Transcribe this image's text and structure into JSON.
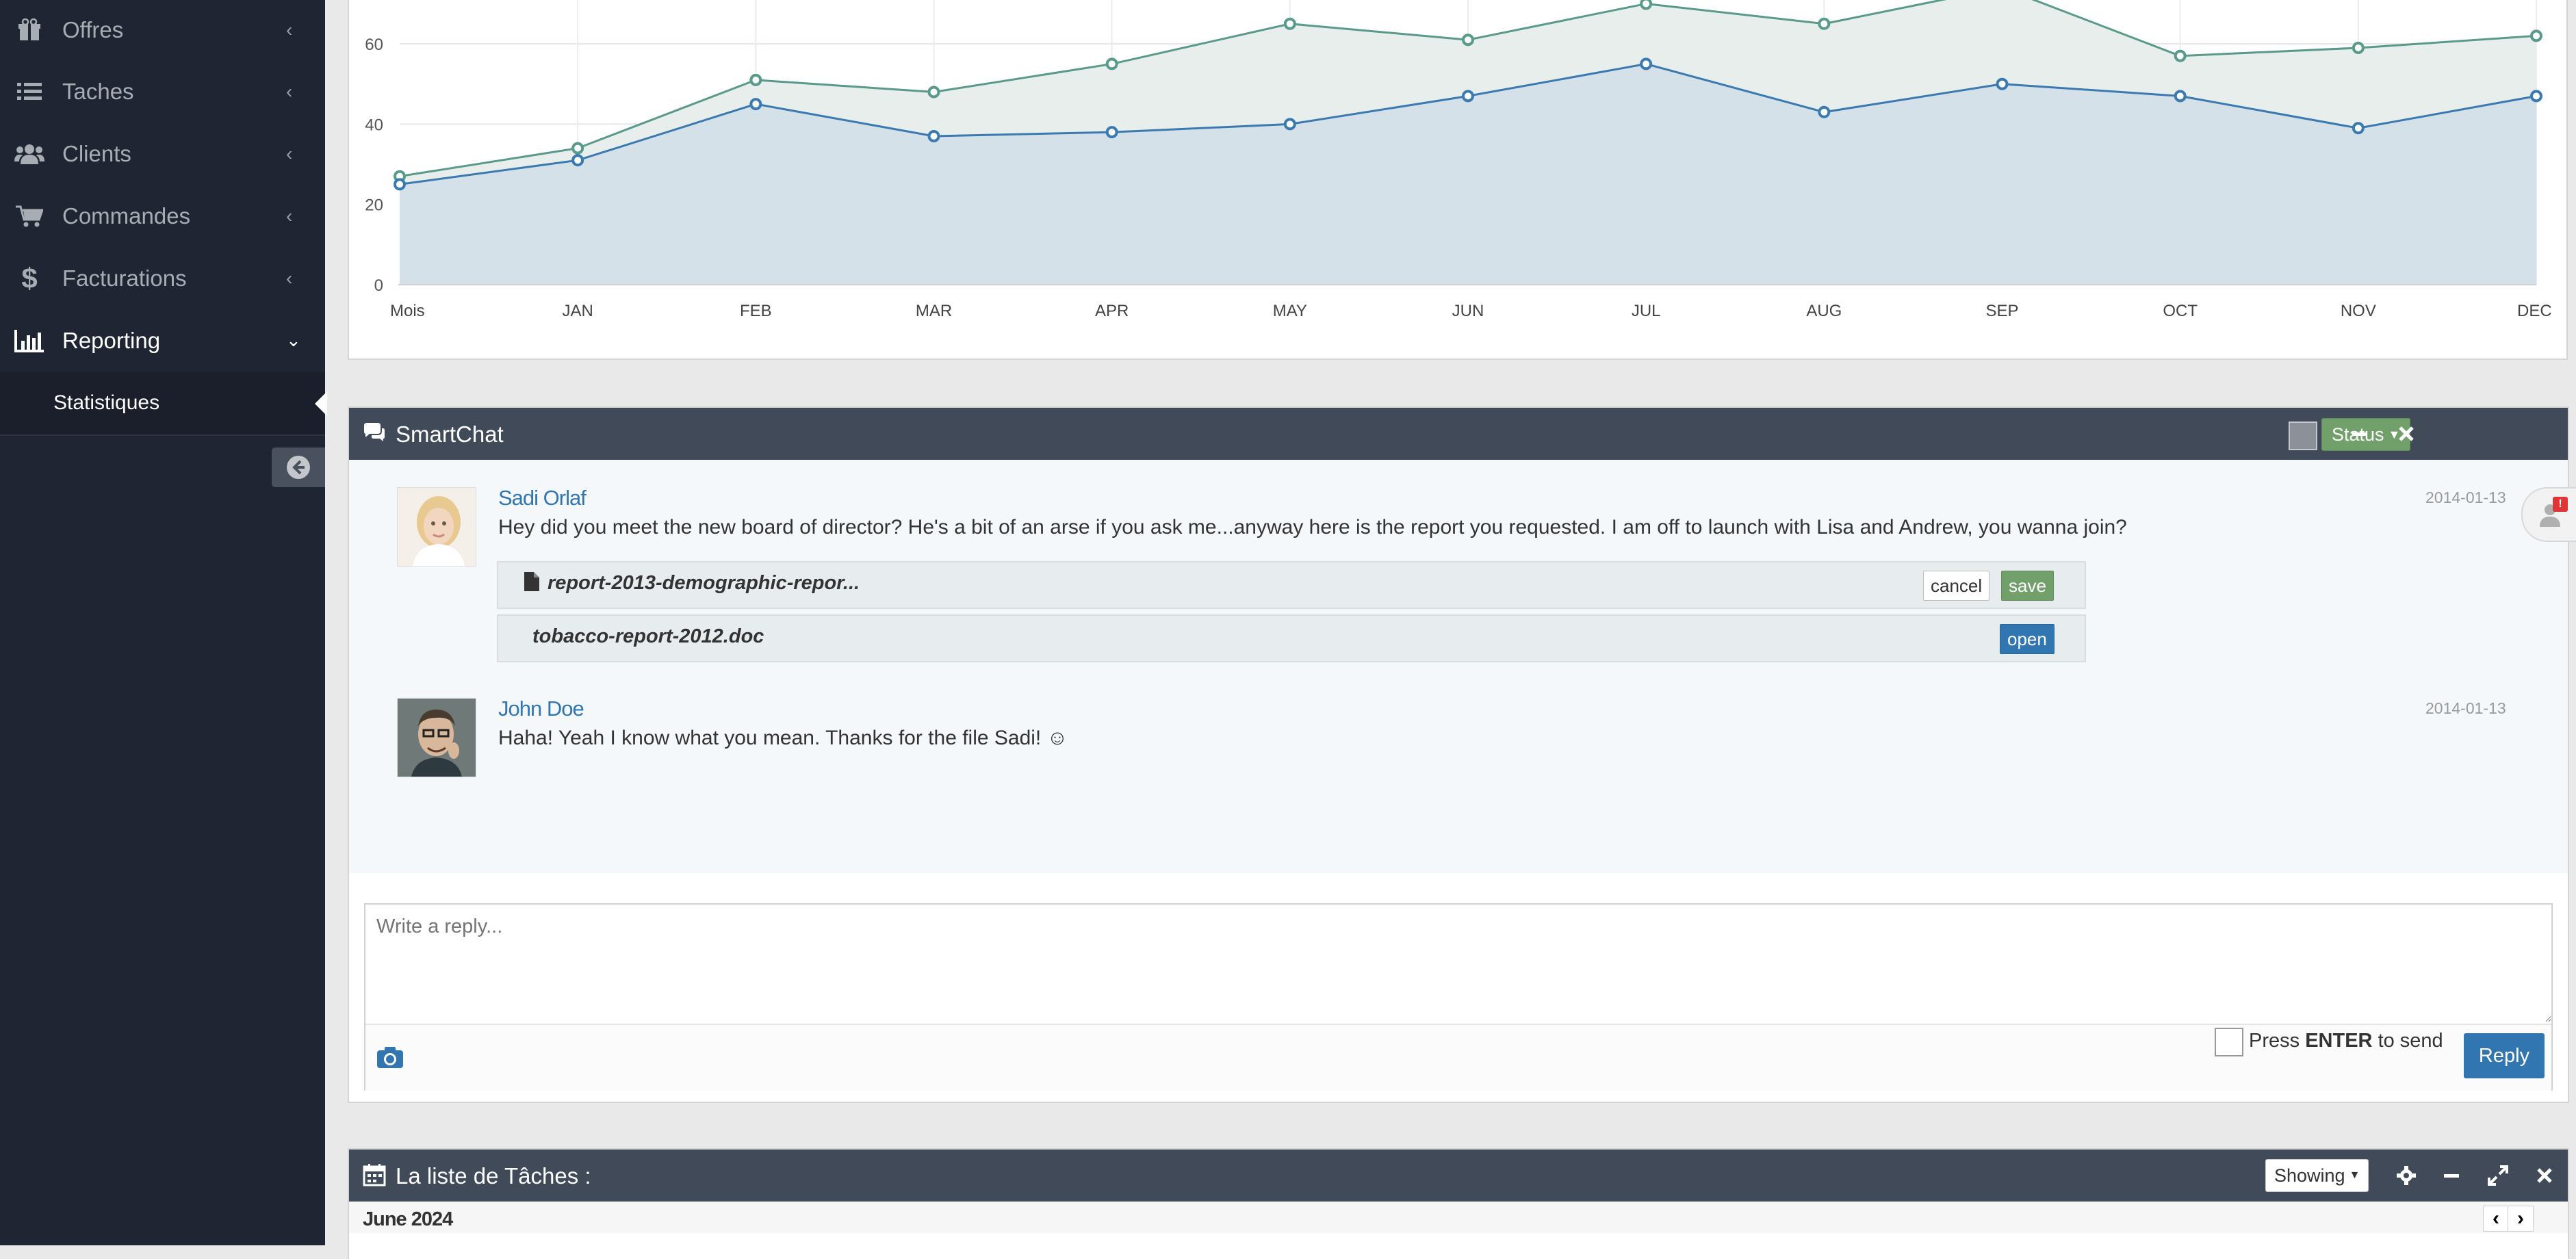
{
  "sidebar": {
    "items": [
      {
        "label": "Offres",
        "icon": "gift-icon"
      },
      {
        "label": "Taches",
        "icon": "list-icon"
      },
      {
        "label": "Clients",
        "icon": "users-icon"
      },
      {
        "label": "Commandes",
        "icon": "cart-icon"
      },
      {
        "label": "Facturations",
        "icon": "dollar-icon"
      },
      {
        "label": "Reporting",
        "icon": "bar-chart-icon",
        "active": true
      }
    ],
    "sub_item": "Statistiques"
  },
  "chart_data": {
    "type": "area",
    "categories": [
      "Mois",
      "JAN",
      "FEB",
      "MAR",
      "APR",
      "MAY",
      "JUN",
      "JUL",
      "AUG",
      "SEP",
      "OCT",
      "NOV",
      "DEC"
    ],
    "series": [
      {
        "values": [
          27,
          34,
          51,
          48,
          55,
          65,
          61,
          70,
          65,
          74,
          57,
          59,
          62
        ],
        "color": "#5a9a8a"
      },
      {
        "values": [
          25,
          31,
          45,
          37,
          38,
          40,
          47,
          55,
          43,
          50,
          47,
          39,
          47
        ],
        "color": "#3b7ab0"
      }
    ],
    "y_ticks": [
      "0",
      "20",
      "40",
      "60"
    ],
    "ylim": [
      0,
      74
    ],
    "grid": true
  },
  "chat": {
    "title": "SmartChat",
    "status_label": "Status",
    "messages": [
      {
        "name": "Sadi Orlaf",
        "date": "2014-01-13",
        "text": "Hey did you meet the new board of director? He's a bit of an arse if you ask me...anyway here is the report you requested. I am off to launch with Lisa and Andrew, you wanna join?"
      },
      {
        "name": "John Doe",
        "date": "2014-01-13",
        "text": "Haha! Yeah I know what you mean. Thanks for the file Sadi! ☺"
      }
    ],
    "attachments": [
      {
        "name": "report-2013-demographic-repor...",
        "cancel": "cancel",
        "save": "save"
      },
      {
        "name": "tobacco-report-2012.doc",
        "open": "open"
      }
    ],
    "reply_placeholder": "Write a reply...",
    "press_label": "Press",
    "enter_label": "ENTER",
    "to_send_label": "to send",
    "reply_button": "Reply"
  },
  "tasks": {
    "title": "La liste de Tâches :",
    "showing_label": "Showing",
    "month": "June 2024"
  }
}
